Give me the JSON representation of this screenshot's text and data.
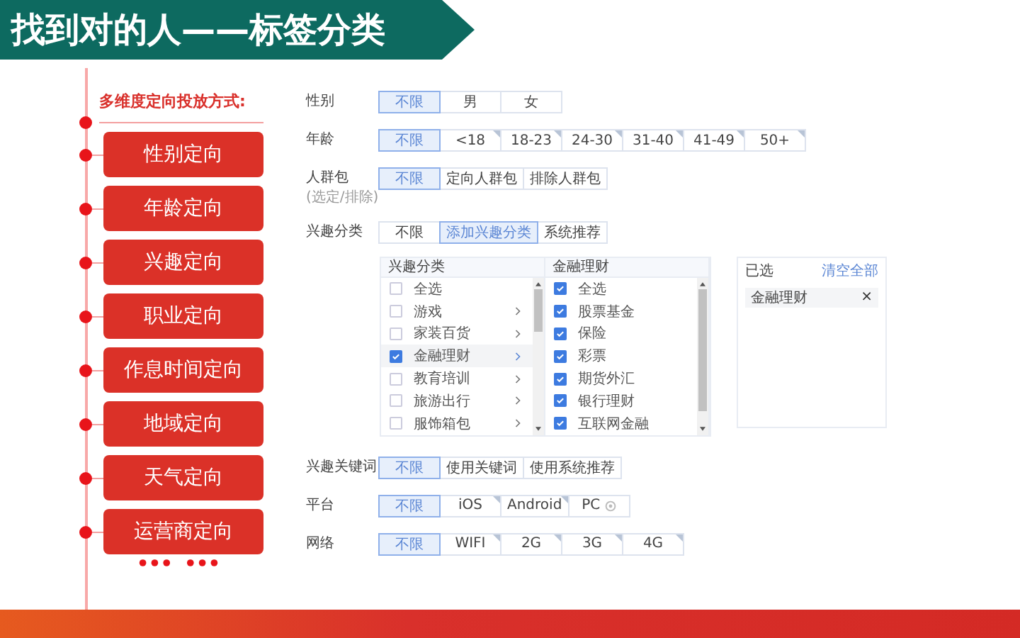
{
  "title": "找到对的人——标签分类",
  "sidebar": {
    "heading": "多维度定向投放方式:",
    "items": [
      "性别定向",
      "年龄定向",
      "兴趣定向",
      "职业定向",
      "作息时间定向",
      "地域定向",
      "天气定向",
      "运营商定向"
    ]
  },
  "form": {
    "rows_top": [
      {
        "label": "性别",
        "options": [
          {
            "label": "不限",
            "selected": true,
            "corner": false
          },
          {
            "label": "男",
            "selected": false,
            "corner": false
          },
          {
            "label": "女",
            "selected": false,
            "corner": false
          }
        ]
      },
      {
        "label": "年龄",
        "options": [
          {
            "label": "不限",
            "selected": true,
            "corner": false
          },
          {
            "label": "<18",
            "selected": false,
            "corner": true
          },
          {
            "label": "18-23",
            "selected": false,
            "corner": true
          },
          {
            "label": "24-30",
            "selected": false,
            "corner": true
          },
          {
            "label": "31-40",
            "selected": false,
            "corner": true
          },
          {
            "label": "41-49",
            "selected": false,
            "corner": true
          },
          {
            "label": "50+",
            "selected": false,
            "corner": true
          }
        ]
      },
      {
        "label": "人群包",
        "sublabel": "(选定/排除)",
        "options": [
          {
            "label": "不限",
            "selected": true,
            "corner": false
          },
          {
            "label": "定向人群包",
            "selected": false,
            "corner": false
          },
          {
            "label": "排除人群包",
            "selected": false,
            "corner": false
          }
        ]
      },
      {
        "label": "兴趣分类",
        "options": [
          {
            "label": "不限",
            "selected": false,
            "corner": false
          },
          {
            "label": "添加兴趣分类",
            "selected": true,
            "corner": false
          },
          {
            "label": "系统推荐",
            "selected": false,
            "corner": false
          }
        ]
      }
    ],
    "interest_panel": {
      "category_header": "兴趣分类",
      "categories": [
        {
          "label": "全选",
          "checked": false,
          "has_children": false,
          "selected": false
        },
        {
          "label": "游戏",
          "checked": false,
          "has_children": true,
          "selected": false
        },
        {
          "label": "家装百货",
          "checked": false,
          "has_children": true,
          "selected": false
        },
        {
          "label": "金融理财",
          "checked": true,
          "has_children": true,
          "selected": true
        },
        {
          "label": "教育培训",
          "checked": false,
          "has_children": true,
          "selected": false
        },
        {
          "label": "旅游出行",
          "checked": false,
          "has_children": true,
          "selected": false
        },
        {
          "label": "服饰箱包",
          "checked": false,
          "has_children": true,
          "selected": false
        }
      ],
      "sub_header": "金融理财",
      "subcategories": [
        {
          "label": "全选",
          "checked": true
        },
        {
          "label": "股票基金",
          "checked": true
        },
        {
          "label": "保险",
          "checked": true
        },
        {
          "label": "彩票",
          "checked": true
        },
        {
          "label": "期货外汇",
          "checked": true
        },
        {
          "label": "银行理财",
          "checked": true
        },
        {
          "label": "互联网金融",
          "checked": true
        }
      ],
      "selected_header": "已选",
      "clear_link": "清空全部",
      "chips": [
        {
          "label": "金融理财",
          "remove": "×"
        }
      ]
    },
    "rows_bottom": [
      {
        "label": "兴趣关键词",
        "options": [
          {
            "label": "不限",
            "selected": true,
            "corner": false
          },
          {
            "label": "使用关键词",
            "selected": false,
            "corner": false
          },
          {
            "label": "使用系统推荐",
            "selected": false,
            "corner": false
          }
        ]
      },
      {
        "label": "平台",
        "options": [
          {
            "label": "不限",
            "selected": true,
            "corner": false
          },
          {
            "label": "iOS",
            "selected": false,
            "corner": true
          },
          {
            "label": "Android",
            "selected": false,
            "corner": true
          },
          {
            "label": "PC",
            "selected": false,
            "corner": false,
            "info": true
          }
        ]
      },
      {
        "label": "网络",
        "options": [
          {
            "label": "不限",
            "selected": true,
            "corner": false
          },
          {
            "label": "WIFI",
            "selected": false,
            "corner": true
          },
          {
            "label": "2G",
            "selected": false,
            "corner": true
          },
          {
            "label": "3G",
            "selected": false,
            "corner": true
          },
          {
            "label": "4G",
            "selected": false,
            "corner": true
          }
        ]
      }
    ]
  }
}
